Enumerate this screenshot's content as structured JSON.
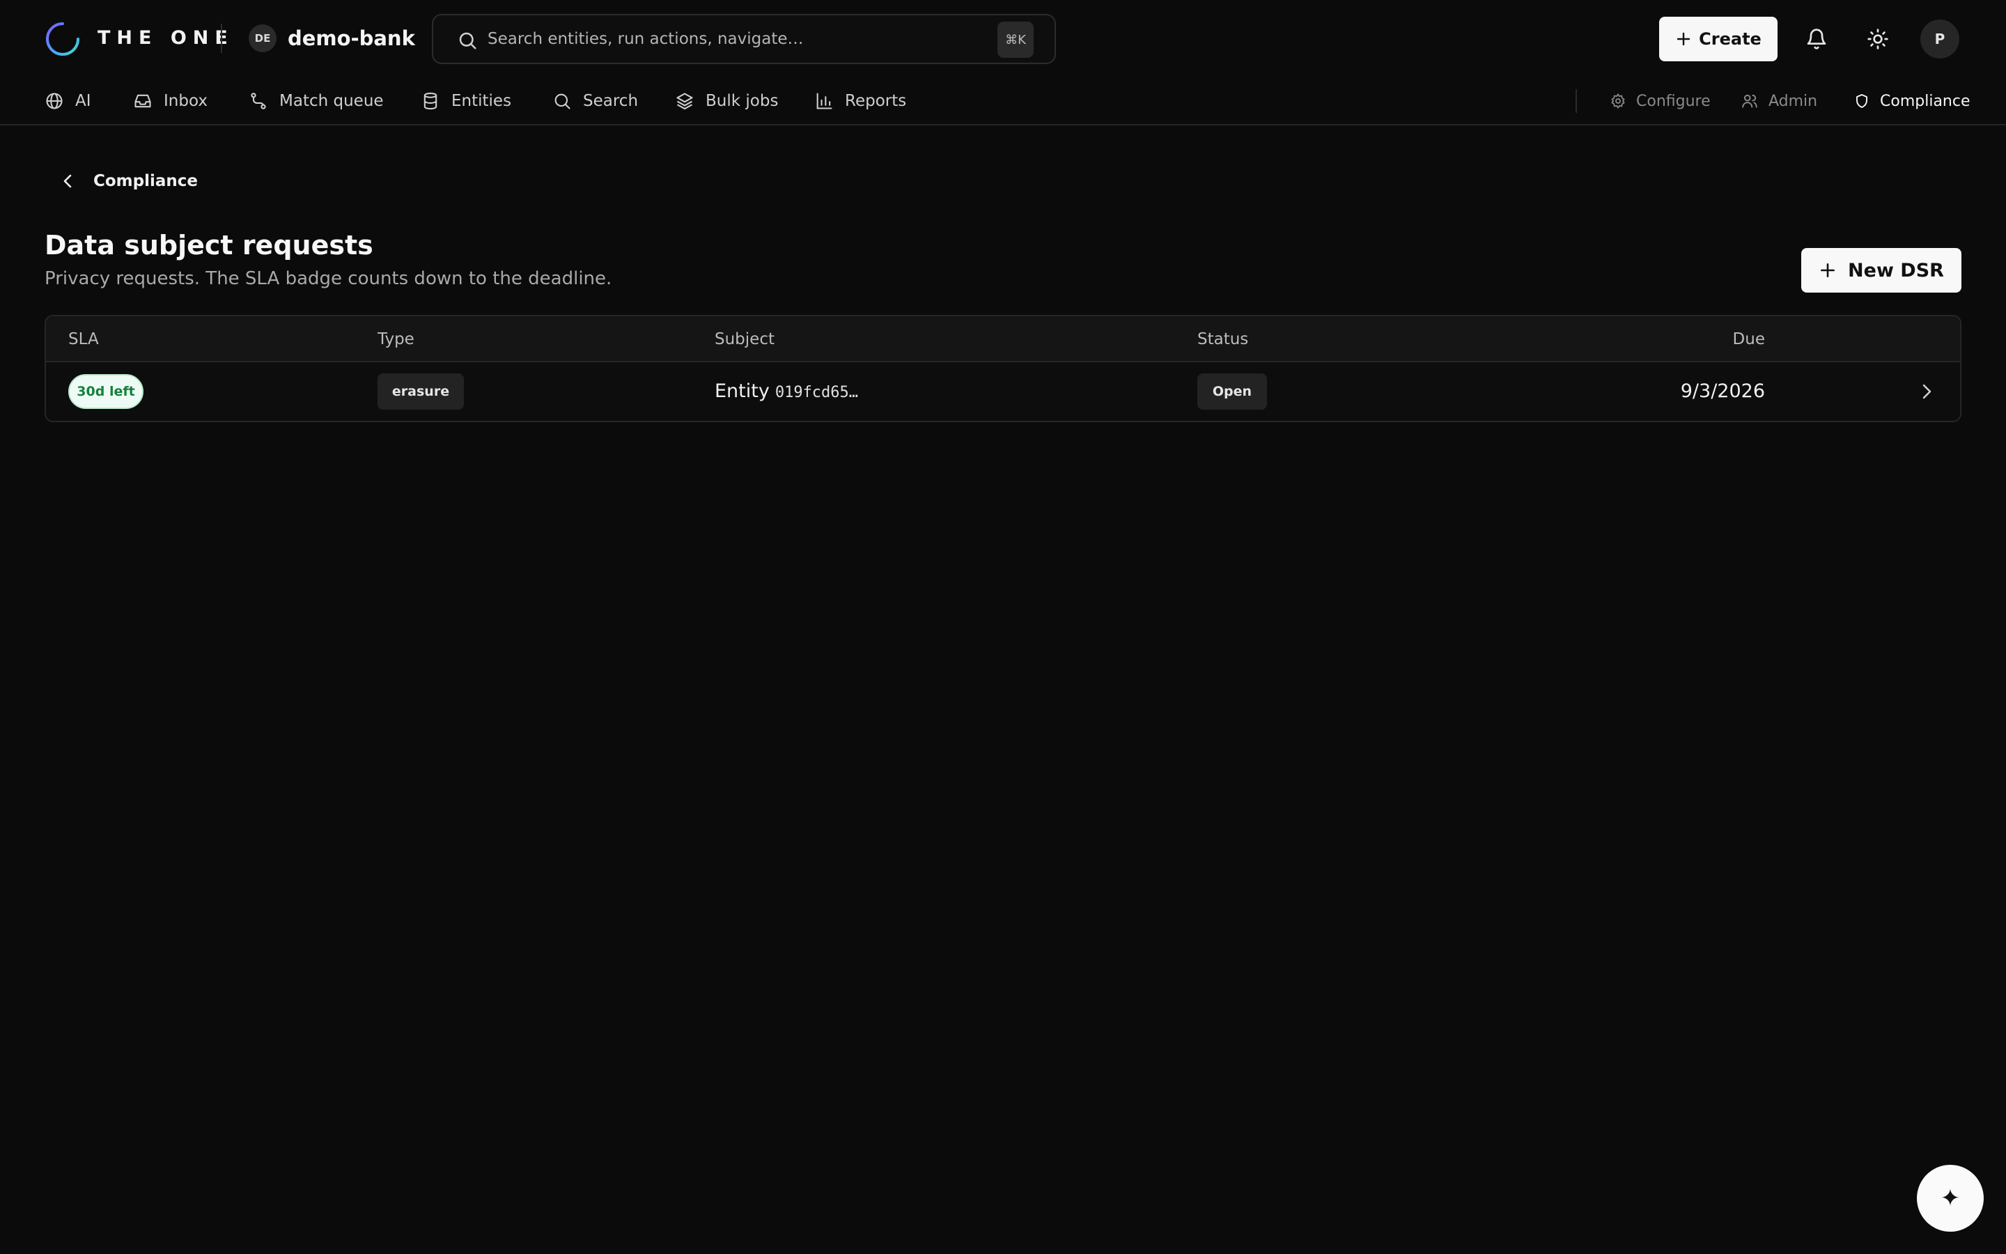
{
  "header": {
    "brand": "THE ONE",
    "org_initials": "DE",
    "org_name": "demo-bank",
    "search_placeholder": "Search entities, run actions, navigate…",
    "search_shortcut": "⌘K",
    "create_label": "Create",
    "avatar_initial": "P",
    "icons": [
      "logo-ring",
      "search-icon",
      "plus-icon",
      "bell-icon",
      "sun-icon"
    ]
  },
  "nav": {
    "primary": [
      {
        "label": "AI",
        "icon": "globe-icon"
      },
      {
        "label": "Inbox",
        "icon": "inbox-icon"
      },
      {
        "label": "Match queue",
        "icon": "route-icon"
      },
      {
        "label": "Entities",
        "icon": "database-icon"
      },
      {
        "label": "Search",
        "icon": "search-icon"
      },
      {
        "label": "Bulk jobs",
        "icon": "layers-icon"
      },
      {
        "label": "Reports",
        "icon": "bar-chart-icon"
      }
    ],
    "secondary": [
      {
        "label": "Configure",
        "icon": "gear-icon"
      },
      {
        "label": "Admin",
        "icon": "users-icon"
      },
      {
        "label": "Compliance",
        "icon": "shield-icon",
        "active": true
      }
    ]
  },
  "page": {
    "back_label": "Compliance",
    "title": "Data subject requests",
    "subtitle": "Privacy requests. The SLA badge counts down to the deadline.",
    "new_button": "New DSR"
  },
  "table": {
    "columns": [
      "SLA",
      "Type",
      "Subject",
      "Status",
      "Due"
    ],
    "rows": [
      {
        "sla": "30d left",
        "type": "erasure",
        "subject_prefix": "Entity",
        "subject_id": "019fcd65…",
        "status": "Open",
        "due": "9/3/2026"
      }
    ]
  },
  "fab": {
    "glyph": "✦"
  },
  "colors": {
    "background": "#0b0b0b",
    "surface": "#151515",
    "border": "#262626",
    "text": "#e8e8e8",
    "muted": "#a9a9a9",
    "sla_ok_bg": "#eefbf4",
    "sla_ok_text": "#15803d",
    "primary_button": "#f7f7f7"
  }
}
